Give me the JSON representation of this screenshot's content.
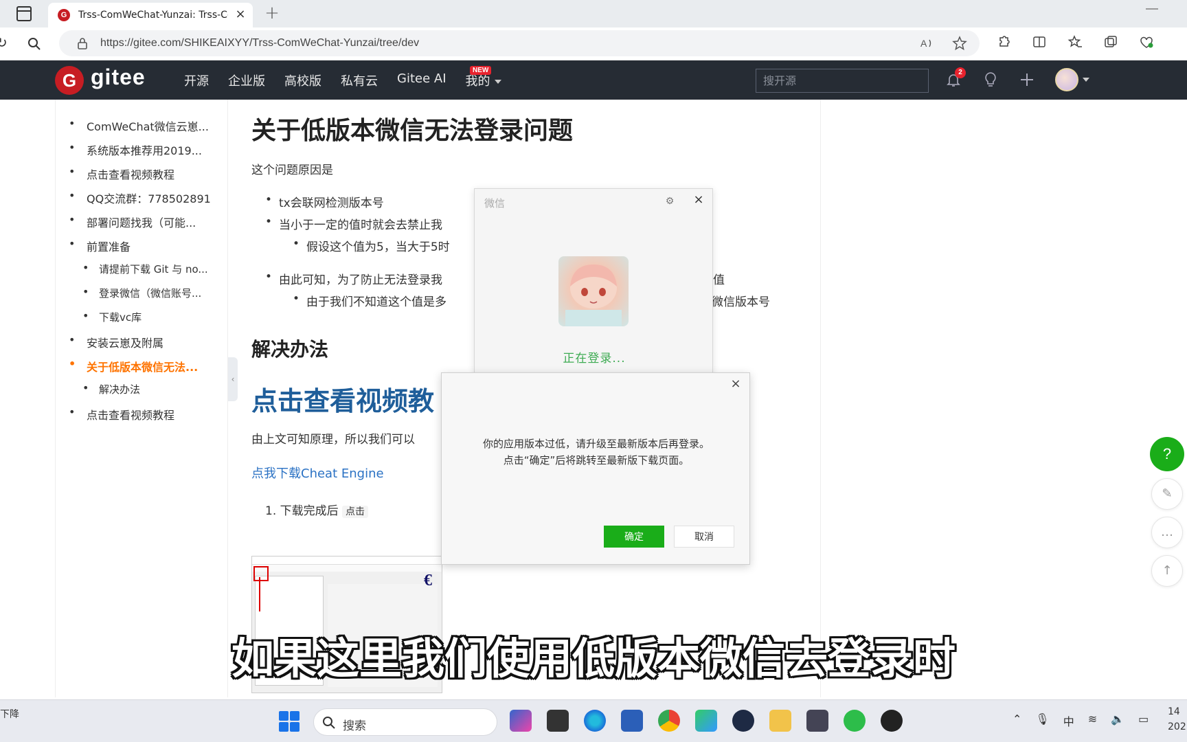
{
  "browser": {
    "tab_title": "Trss-ComWeChat-Yunzai: Trss-Co",
    "url": "https://gitee.com/SHIKEAIXYY/Trss-ComWeChat-Yunzai/tree/dev"
  },
  "gitee": {
    "brand": "gitee",
    "nav": [
      "开源",
      "企业版",
      "高校版",
      "私有云",
      "Gitee AI",
      "我的"
    ],
    "new_badge": "NEW",
    "search_placeholder": "搜开源",
    "notification_count": "2"
  },
  "toc": {
    "items": [
      {
        "label": "ComWeChat微信云崽...",
        "level": 1,
        "active": false
      },
      {
        "label": "系统版本推荐用2019...",
        "level": 1,
        "active": false
      },
      {
        "label": "点击查看视频教程",
        "level": 1,
        "active": false
      },
      {
        "label": "QQ交流群：778502891",
        "level": 1,
        "active": false
      },
      {
        "label": "部署问题找我（可能...",
        "level": 1,
        "active": false
      },
      {
        "label": "前置准备",
        "level": 1,
        "active": false
      },
      {
        "label": "请提前下载 Git 与 no...",
        "level": 2,
        "active": false
      },
      {
        "label": "登录微信（微信账号...",
        "level": 2,
        "active": false
      },
      {
        "label": "下载vc库",
        "level": 2,
        "active": false
      },
      {
        "label": "安装云崽及附属",
        "level": 1,
        "active": false
      },
      {
        "label": "关于低版本微信无法...",
        "level": 1,
        "active": true
      },
      {
        "label": "解决办法",
        "level": 2,
        "active": false
      },
      {
        "label": "点击查看视频教程",
        "level": 1,
        "active": false
      }
    ]
  },
  "content": {
    "heading": "关于低版本微信无法登录问题",
    "intro": "这个问题原因是",
    "bullet1": "tx会联网检测版本号",
    "bullet2": "当小于一定的值时就会去禁止我",
    "bullet2_sub": "假设这个值为5，当大于5时",
    "bullet3": "由此可知，为了防止无法登录我",
    "bullet3_tail": "值",
    "bullet3_sub": "由于我们不知道这个值是多",
    "bullet3_sub_tail": "微信版本号",
    "heading2": "解决办法",
    "video_heading": "点击查看视频教",
    "para2": "由上文可知原理，所以我们可以",
    "download_link": "点我下载Cheat Engine",
    "step1_prefix": "下载完成后",
    "step1_code": "点击"
  },
  "wechat_login": {
    "title": "微信",
    "status": "正在登录..."
  },
  "version_dialog": {
    "message_line1": "你的应用版本过低，请升级至最新版本后再登录。",
    "message_line2": "点击“确定”后将跳转至最新版下载页面。",
    "ok_label": "确定",
    "cancel_label": "取消"
  },
  "float_buttons": {
    "help_label": "?"
  },
  "caption": "如果这里我们使用低版本微信去登录时",
  "taskbar": {
    "left_text": "下降",
    "search_label": "搜索",
    "clock_line1": "14",
    "clock_line2": "202"
  },
  "colors": {
    "gitee_header_bg": "#262c34",
    "gitee_red": "#c71d23",
    "toc_active": "#fe7300",
    "link_blue": "#2b72c4",
    "wechat_green": "#1aad19"
  }
}
